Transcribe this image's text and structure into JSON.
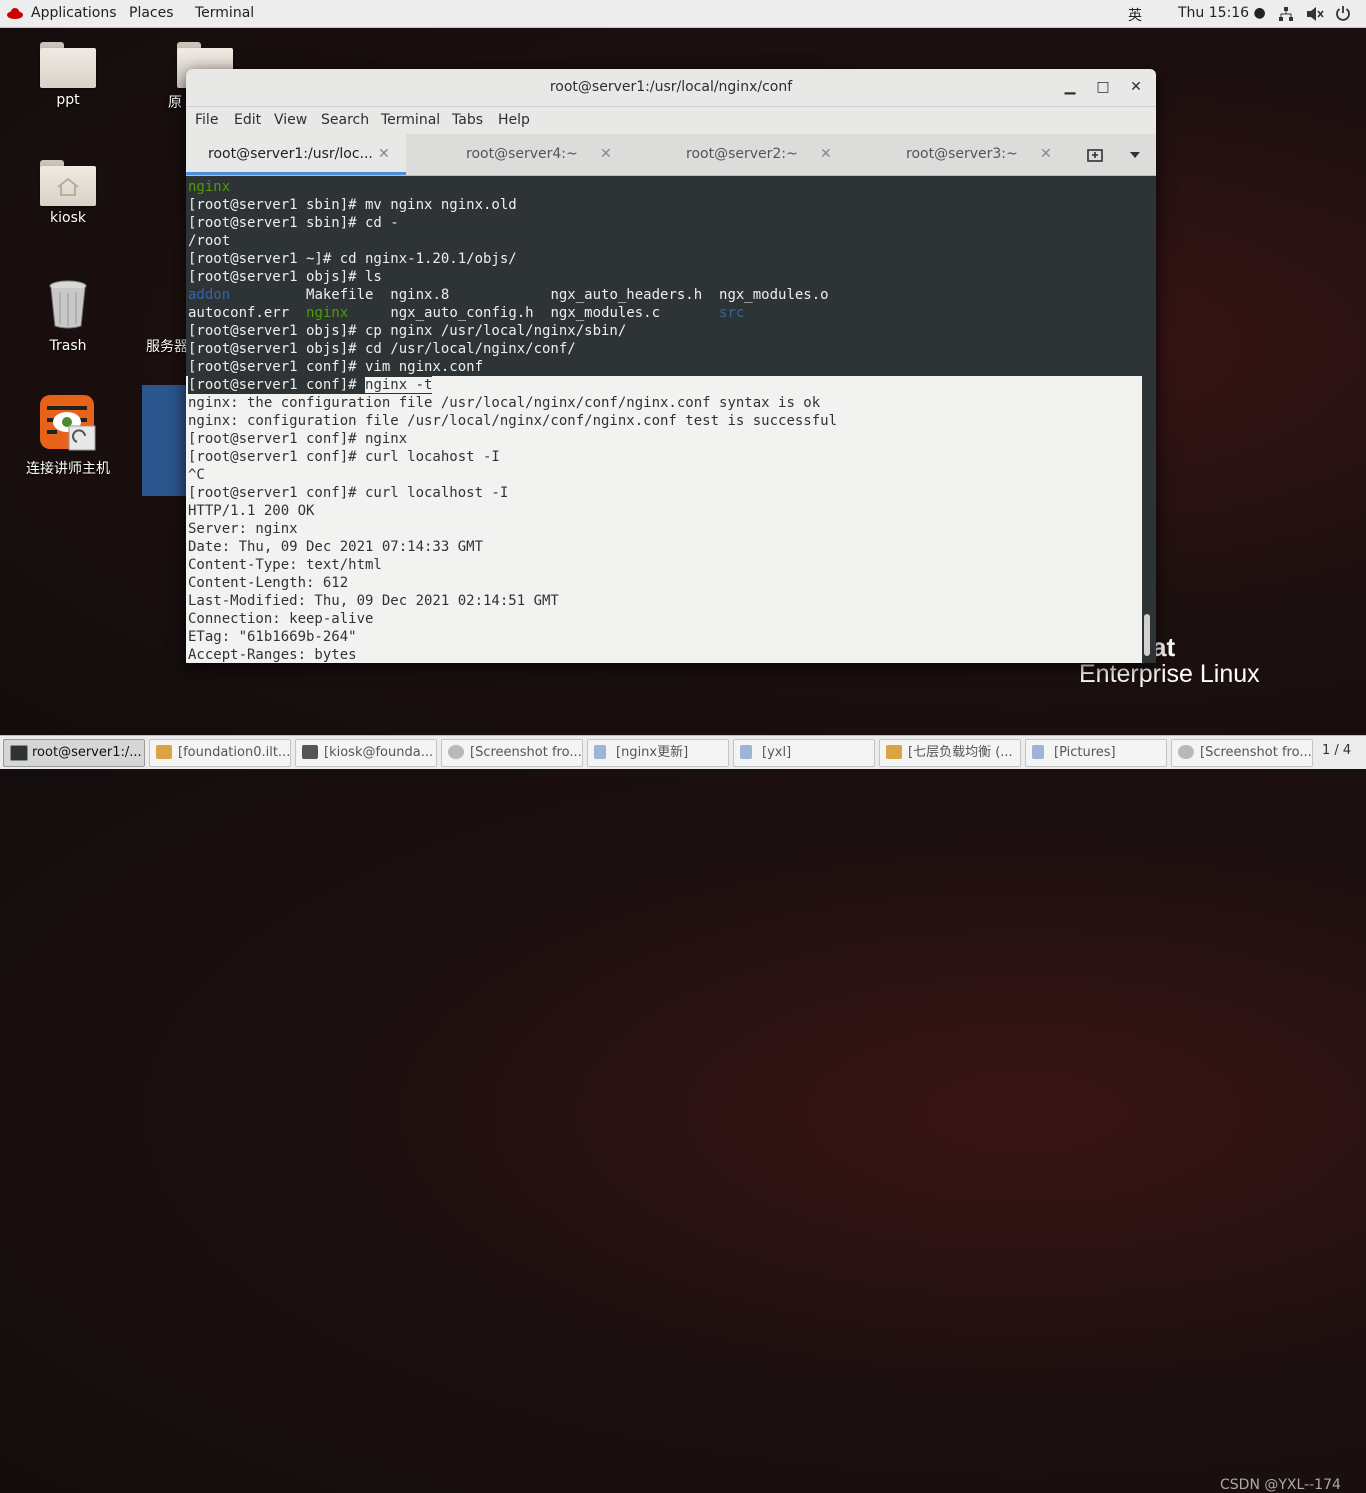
{
  "topbar": {
    "applications": "Applications",
    "places": "Places",
    "terminal": "Terminal",
    "input_method": "英",
    "clock": "Thu 15:16 ●"
  },
  "desktop": {
    "icons": [
      {
        "label": "ppt"
      },
      {
        "label": "原"
      },
      {
        "label": "kiosk"
      },
      {
        "label": "Trash"
      },
      {
        "label": "服务器"
      },
      {
        "label": "连接讲师主机"
      }
    ]
  },
  "window": {
    "title": "root@server1:/usr/local/nginx/conf",
    "menu": [
      "File",
      "Edit",
      "View",
      "Search",
      "Terminal",
      "Tabs",
      "Help"
    ],
    "tabs": [
      {
        "label": "root@server1:/usr/loc..."
      },
      {
        "label": "root@server4:~"
      },
      {
        "label": "root@server2:~"
      },
      {
        "label": "root@server3:~"
      }
    ]
  },
  "terminal": {
    "lines": [
      "nginx",
      "[root@server1 sbin]# mv nginx nginx.old",
      "[root@server1 sbin]# cd -",
      "/root",
      "[root@server1 ~]# cd nginx-1.20.1/objs/",
      "[root@server1 objs]# ls",
      "addon         Makefile  nginx.8            ngx_auto_headers.h  ngx_modules.o",
      "autoconf.err  nginx     ngx_auto_config.h  ngx_modules.c       src",
      "[root@server1 objs]# cp nginx /usr/local/nginx/sbin/",
      "[root@server1 objs]# cd /usr/local/nginx/conf/",
      "[root@server1 conf]# vim nginx.conf",
      "[root@server1 conf]# nginx -t",
      "nginx: the configuration file /usr/local/nginx/conf/nginx.conf syntax is ok",
      "nginx: configuration file /usr/local/nginx/conf/nginx.conf test is successful",
      "[root@server1 conf]# nginx",
      "[root@server1 conf]# curl locahost -I",
      "^C",
      "[root@server1 conf]# curl localhost -I",
      "HTTP/1.1 200 OK",
      "Server: nginx",
      "Date: Thu, 09 Dec 2021 07:14:33 GMT",
      "Content-Type: text/html",
      "Content-Length: 612",
      "Last-Modified: Thu, 09 Dec 2021 02:14:51 GMT",
      "Connection: keep-alive",
      "ETag: \"61b1669b-264\"",
      "Accept-Ranges: bytes"
    ],
    "ls_row1": {
      "addon": "addon",
      "rest": "         Makefile  nginx.8            ngx_auto_headers.h  ngx_modules.o"
    },
    "ls_row2": {
      "a": "autoconf.err  ",
      "nginx": "nginx",
      "b": "     ngx_auto_config.h  ngx_modules.c       ",
      "src": "src"
    },
    "sel_prompt": "[root@server1 conf]# ",
    "sel_cmd": "nginx -t"
  },
  "branding": {
    "at": "at",
    "product": "Enterprise Linux"
  },
  "taskbar": {
    "items": [
      {
        "label": "root@server1:/..."
      },
      {
        "label": "[foundation0.ilt...."
      },
      {
        "label": "[kiosk@founda..."
      },
      {
        "label": "[Screenshot fro..."
      },
      {
        "label": "[nginx更新]"
      },
      {
        "label": "[yxl]"
      },
      {
        "label": "[七层负载均衡 (..."
      },
      {
        "label": "[Pictures]"
      },
      {
        "label": "[Screenshot fro..."
      }
    ],
    "watermark": "CSDN @YXL--174",
    "pager": "1 / 4"
  }
}
